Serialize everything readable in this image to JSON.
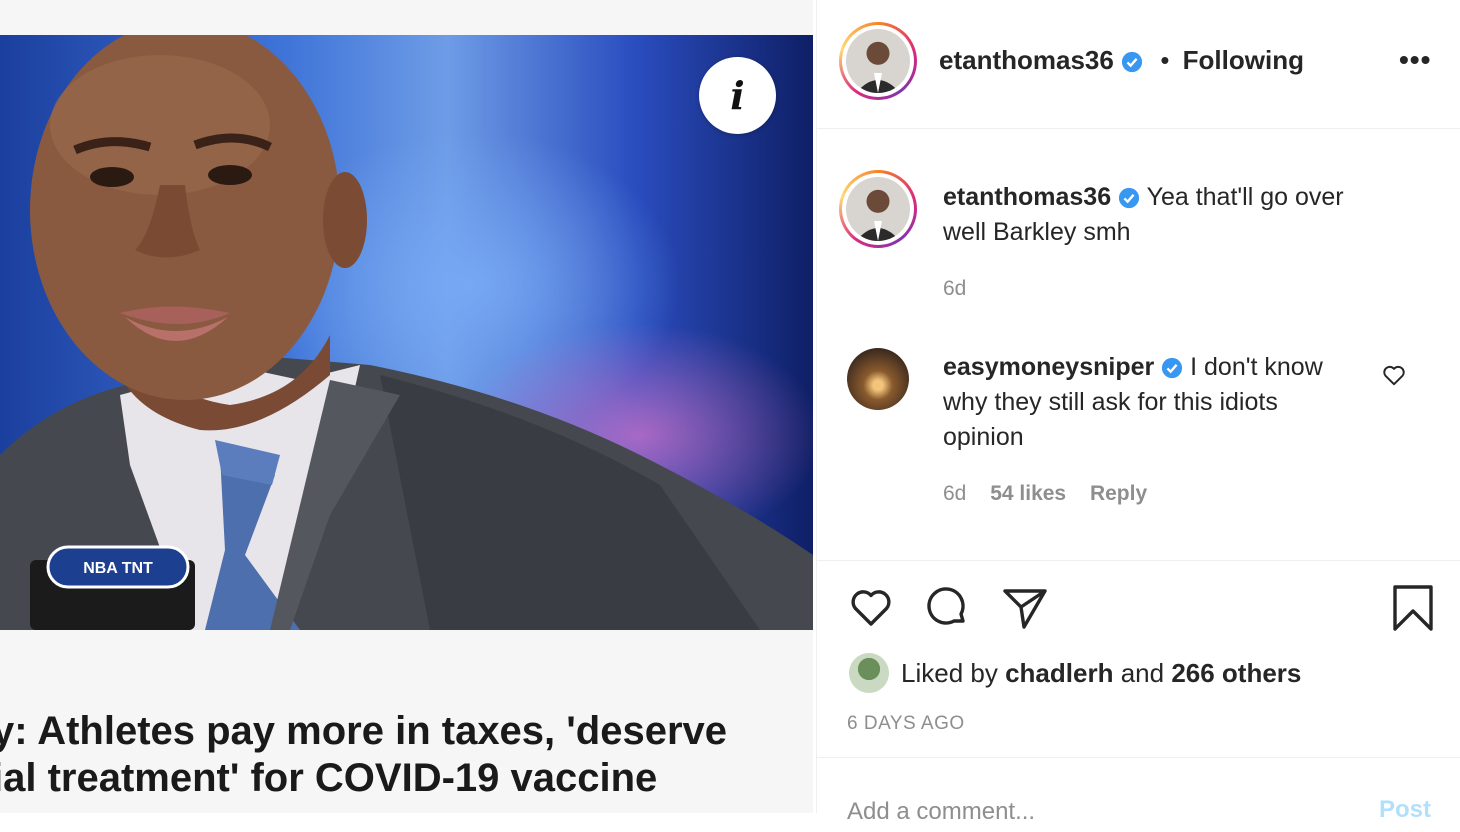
{
  "post": {
    "headline_lines": [
      "y: Athletes pay more in taxes, 'deserve",
      "ial treatment' for COVID-19 vaccine"
    ],
    "info_icon": "info-icon",
    "mic_flag_text": "NBA TNT"
  },
  "header": {
    "username": "etanthomas36",
    "separator": "•",
    "follow_status": "Following",
    "more_icon": "more-options-icon"
  },
  "comments": [
    {
      "username": "etanthomas36",
      "text": "Yea that'll go over well Barkley smh",
      "time": "6d"
    },
    {
      "username": "easymoneysniper",
      "text": "I don't know why they still ask for this idiots opinion",
      "time": "6d",
      "likes": "54 likes",
      "reply_label": "Reply"
    }
  ],
  "actions": {
    "icons": [
      "heart-icon",
      "comment-icon",
      "share-icon",
      "bookmark-icon"
    ],
    "liked_by_prefix": "Liked by",
    "liked_by_user": "chadlerh",
    "liked_by_and": "and",
    "liked_by_others": "266 others",
    "time_ago": "6 DAYS AGO"
  },
  "comment_box": {
    "placeholder": "Add a comment...",
    "post_label": "Post"
  },
  "colors": {
    "verified": "#3897f0",
    "post_disabled": "#b2dffc",
    "muted": "#8e8e8e"
  }
}
